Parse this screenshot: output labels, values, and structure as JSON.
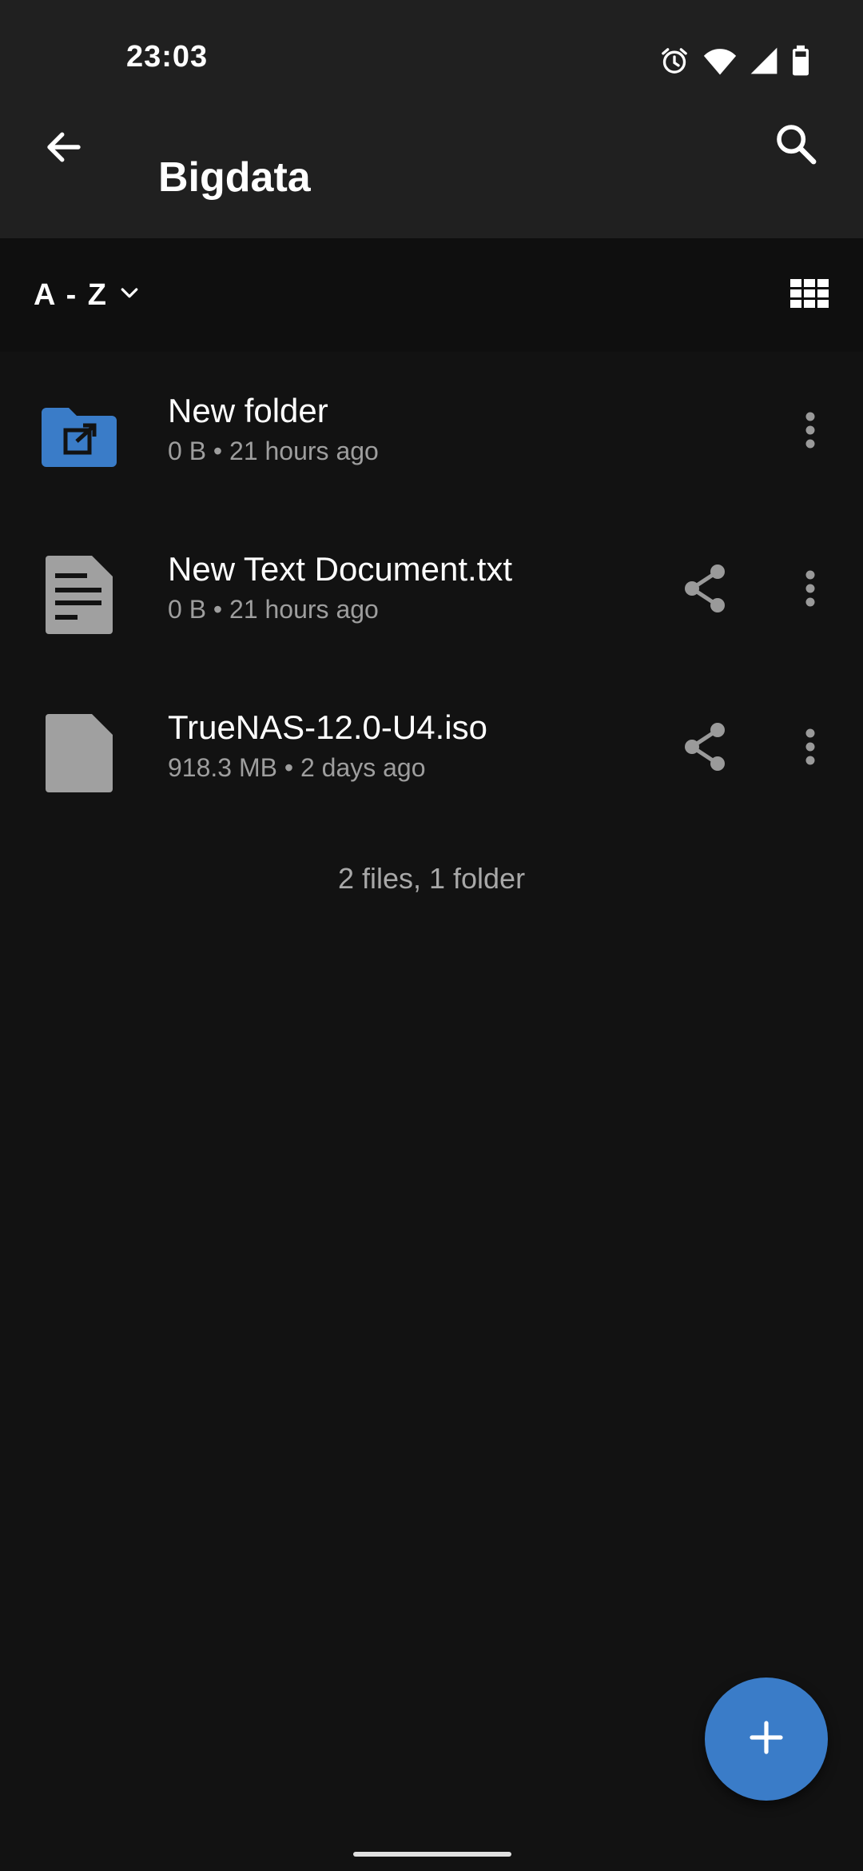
{
  "status_bar": {
    "time": "23:03",
    "icons": [
      "alarm-icon",
      "wifi-icon",
      "signal-icon",
      "battery-icon"
    ]
  },
  "app_bar": {
    "title": "Bigdata",
    "back_icon": "arrow-back-icon",
    "search_icon": "search-icon"
  },
  "sort_bar": {
    "label": "A - Z",
    "dropdown_icon": "chevron-down-icon",
    "view_toggle_icon": "grid-view-icon"
  },
  "files": [
    {
      "name": "New folder",
      "size": "0 B",
      "modified": "21 hours ago",
      "meta": "0 B • 21 hours ago",
      "type": "shared-folder",
      "icon": "shared-folder-icon",
      "shareable": false
    },
    {
      "name": "New Text Document.txt",
      "size": "0 B",
      "modified": "21 hours ago",
      "meta": "0 B • 21 hours ago",
      "type": "text-document",
      "icon": "text-document-icon",
      "shareable": true
    },
    {
      "name": "TrueNAS-12.0-U4.iso",
      "size": "918.3 MB",
      "modified": "2 days ago",
      "meta": "918.3 MB • 2 days ago",
      "type": "file",
      "icon": "file-icon",
      "shareable": true
    }
  ],
  "summary": "2 files, 1 folder",
  "fab": {
    "icon": "plus-icon"
  },
  "colors": {
    "background": "#121212",
    "app_bar": "#202020",
    "sort_bar": "#0f0f0f",
    "accent": "#3a7cc8",
    "secondary_text": "#9e9e9e",
    "icon_gray": "#9a9a9a"
  }
}
